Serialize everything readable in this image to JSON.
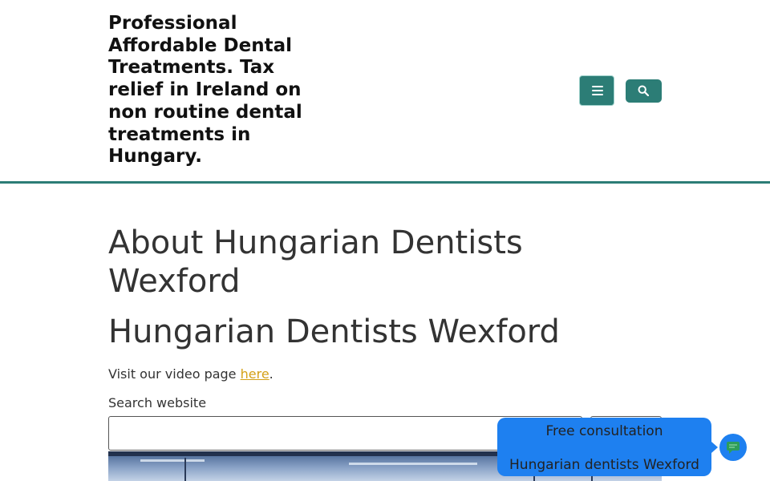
{
  "header": {
    "site_title": "Professional Affordable Dental Treatments. Tax relief in Ireland on non routine dental treatments in Hungary.",
    "menu_icon": "hamburger-icon",
    "search_icon": "magnifier-icon",
    "accent_color": "#2c7d76"
  },
  "main": {
    "title": "About Hungarian Dentists Wexford",
    "subtitle": "Hungarian Dentists Wexford",
    "video_prefix": "Visit our video page ",
    "video_link": "here",
    "video_suffix": ".",
    "link_color": "#d4a017",
    "search_label": "Search website",
    "search_value": "",
    "search_submit": ""
  },
  "chat": {
    "line1": "Free consultation",
    "line2": "Hungarian dentists Wexford",
    "launcher_icon": "chat-message-icon",
    "bubble_color": "#1e80f0"
  }
}
